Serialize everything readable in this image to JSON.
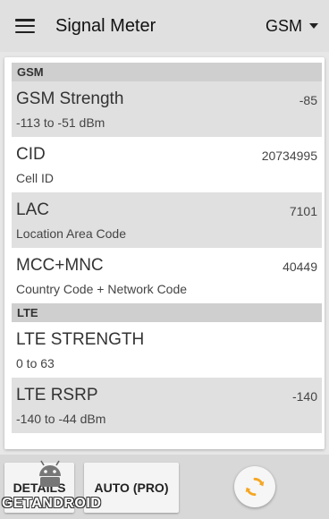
{
  "toolbar": {
    "title": "Signal Meter",
    "network_type": "GSM"
  },
  "sections": {
    "gsm_label": "GSM",
    "lte_label": "LTE"
  },
  "rows": [
    {
      "title": "GSM Strength",
      "subtitle": "-113 to -51 dBm",
      "value": "-85"
    },
    {
      "title": "CID",
      "subtitle": "Cell ID",
      "value": "20734995"
    },
    {
      "title": "LAC",
      "subtitle": "Location Area Code",
      "value": "7101"
    },
    {
      "title": "MCC+MNC",
      "subtitle": "Country Code + Network Code",
      "value": "40449"
    },
    {
      "title": "LTE STRENGTH",
      "subtitle": "0 to 63",
      "value": ""
    },
    {
      "title": "LTE RSRP",
      "subtitle": "-140 to -44 dBm",
      "value": "-140"
    }
  ],
  "bottom_bar": {
    "details_label": "DETAILS",
    "auto_label": "AUTO (PRO)",
    "refresh_icon": "refresh-icon"
  },
  "watermark": {
    "text": "GETANDROID"
  },
  "colors": {
    "accent": "#f5a623",
    "toolbar_bg": "#e0e0e0",
    "section_bg": "#cfcfcf",
    "row_shaded_bg": "#e0e0e0"
  }
}
